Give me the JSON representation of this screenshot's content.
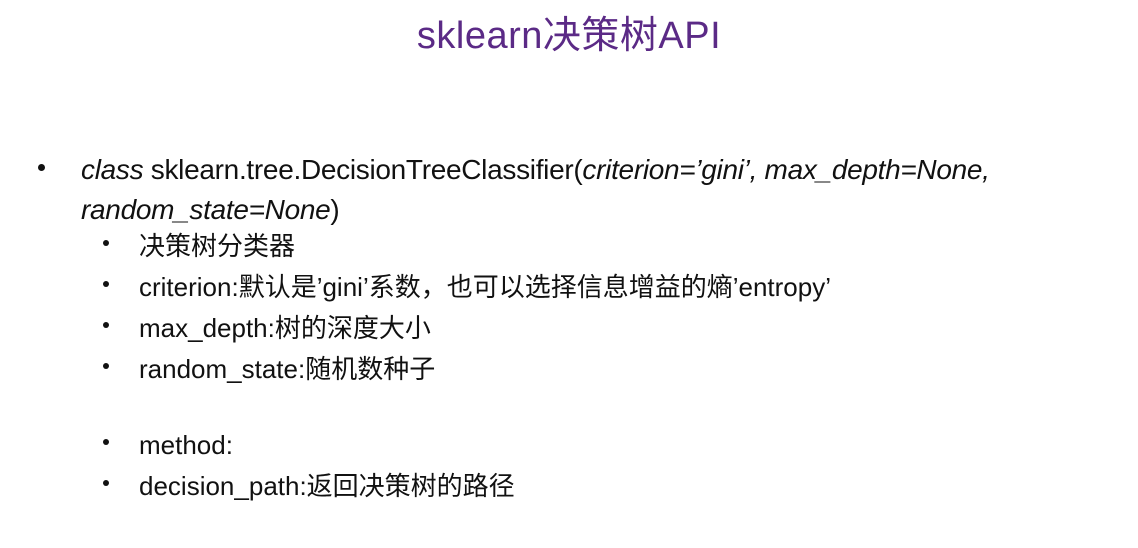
{
  "title": "sklearn决策树API",
  "main_item": {
    "class_keyword": "class",
    "class_name": " sklearn.tree.DecisionTreeClassifier(",
    "params": "criterion=’gini’, max_depth=None,",
    "params_line2": "random_state=None",
    "close_paren": ")"
  },
  "sub_items": [
    "决策树分类器",
    "criterion:默认是’gini’系数，也可以选择信息增益的熵’entropy’",
    "max_depth:树的深度大小",
    "random_state:随机数种子",
    "method:",
    "decision_path:返回决策树的路径"
  ]
}
